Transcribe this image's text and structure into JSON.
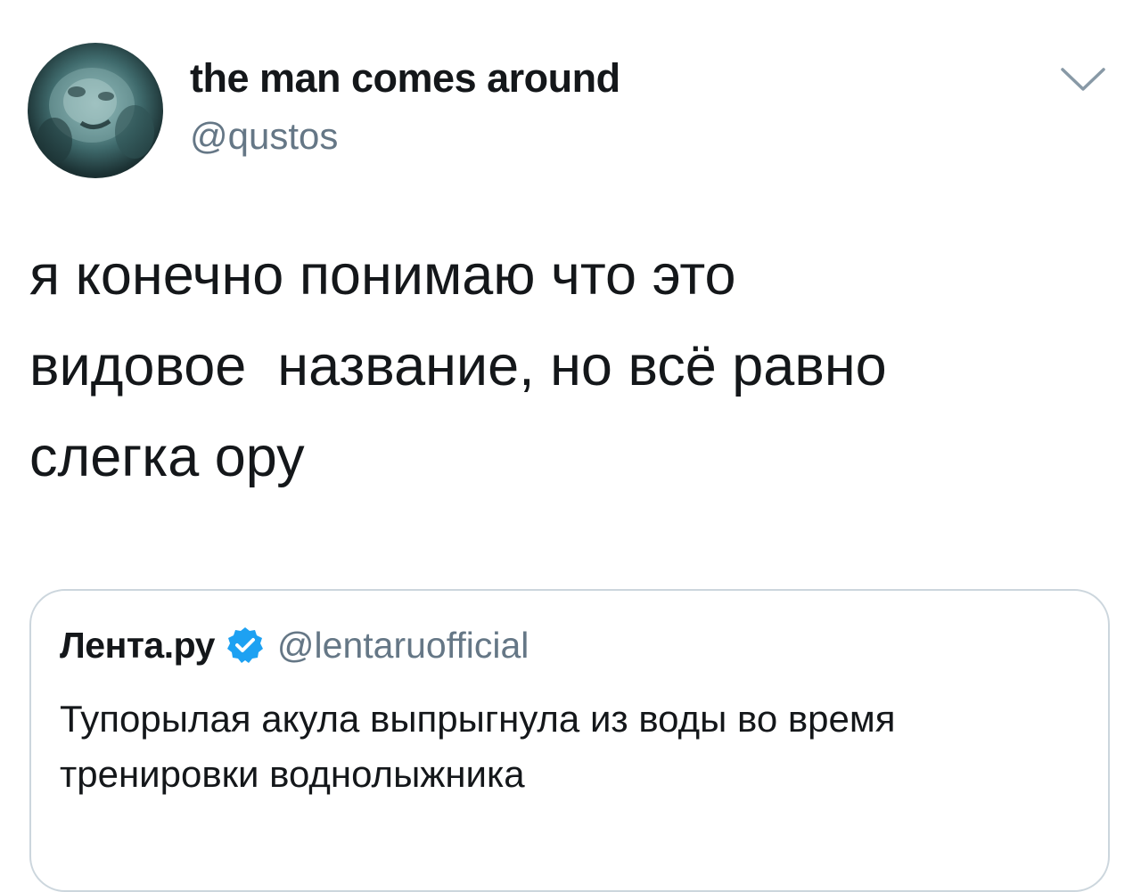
{
  "tweet": {
    "author": {
      "display_name": "the man comes around",
      "handle": "@qustos",
      "avatar_icon": "avatar-photo"
    },
    "menu_icon": "chevron-down-icon",
    "text": "я конечно понимаю что это\nвидовое  название, но всё равно\nслегка ору",
    "quoted_tweet": {
      "display_name": "Лента.ру",
      "verified_icon": "verified-badge-icon",
      "handle": "@lentaruofficial",
      "text": "Тупорылая акула выпрыгнула из воды во время\nтренировки воднолыжника"
    }
  },
  "colors": {
    "text_primary": "#14171a",
    "text_secondary": "#657786",
    "border": "#ccd6dd",
    "verified_blue": "#1da1f2"
  }
}
